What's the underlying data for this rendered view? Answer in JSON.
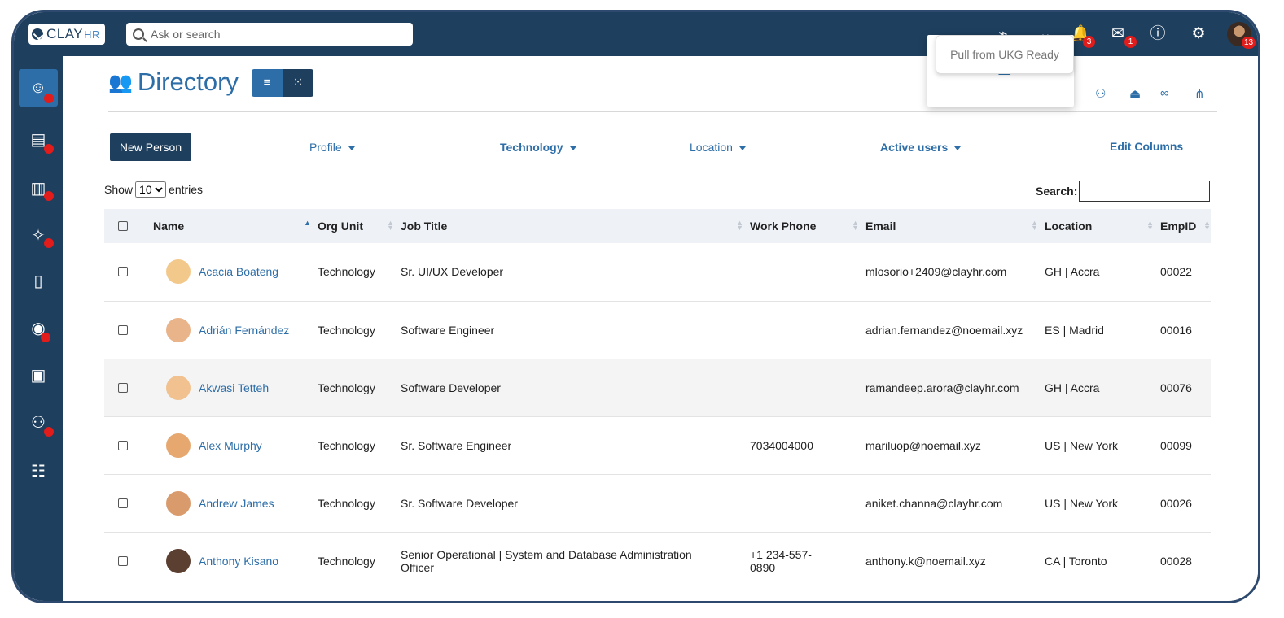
{
  "app": {
    "logo_text": "CLAY",
    "logo_suffix": "HR"
  },
  "search": {
    "placeholder": "Ask or search"
  },
  "topbar": {
    "notification_count": "3",
    "mail_count": "1",
    "avatar_count": "13"
  },
  "header": {
    "title": "Directory"
  },
  "tooltip": {
    "text": "Pull from UKG Ready"
  },
  "toolbar": {
    "new_person": "New Person",
    "filters": [
      {
        "label": "Profile",
        "bold": false
      },
      {
        "label": "Technology",
        "bold": true
      },
      {
        "label": "Location",
        "bold": false
      },
      {
        "label": "Active users",
        "bold": true
      }
    ],
    "edit_columns": "Edit Columns"
  },
  "table_controls": {
    "show_label": "Show",
    "entries_value": "10",
    "entries_label": "entries",
    "search_label": "Search:"
  },
  "table": {
    "columns": [
      "Name",
      "Org Unit",
      "Job Title",
      "Work Phone",
      "Email",
      "Location",
      "EmpID"
    ],
    "rows": [
      {
        "name": "Acacia Boateng",
        "org": "Technology",
        "title": "Sr. UI/UX Developer",
        "phone": "",
        "email": "mlosorio+2409@clayhr.com",
        "location": "GH | Accra",
        "id": "00022",
        "avatar_color": "#f3c98b"
      },
      {
        "name": "Adrián Fernández",
        "org": "Technology",
        "title": "Software Engineer",
        "phone": "",
        "email": "adrian.fernandez@noemail.xyz",
        "location": "ES | Madrid",
        "id": "00016",
        "avatar_color": "#e9b48a"
      },
      {
        "name": "Akwasi Tetteh",
        "org": "Technology",
        "title": "Software Developer",
        "phone": "",
        "email": "ramandeep.arora@clayhr.com",
        "location": "GH | Accra",
        "id": "00076",
        "avatar_color": "#f1c28f"
      },
      {
        "name": "Alex Murphy",
        "org": "Technology",
        "title": "Sr. Software Engineer",
        "phone": "7034004000",
        "email": "mariluop@noemail.xyz",
        "location": "US | New York",
        "id": "00099",
        "avatar_color": "#e6a86f"
      },
      {
        "name": "Andrew James",
        "org": "Technology",
        "title": "Sr. Software Developer",
        "phone": "",
        "email": "aniket.channa@clayhr.com",
        "location": "US | New York",
        "id": "00026",
        "avatar_color": "#d99b6c"
      },
      {
        "name": "Anthony Kisano",
        "org": "Technology",
        "title": "Senior Operational | System and Database Administration Officer",
        "phone": "+1 234-557-0890",
        "email": "anthony.k@noemail.xyz",
        "location": "CA | Toronto",
        "id": "00028",
        "avatar_color": "#5b3f31"
      }
    ]
  }
}
